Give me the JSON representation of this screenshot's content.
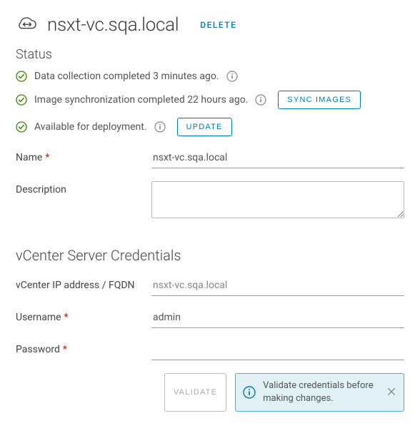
{
  "header": {
    "title": "nsxt-vc.sqa.local",
    "delete_label": "DELETE"
  },
  "status": {
    "section_label": "Status",
    "items": [
      {
        "text": "Data collection completed 3 minutes ago."
      },
      {
        "text": "Image synchronization completed 22 hours ago.",
        "action_label": "SYNC IMAGES"
      },
      {
        "text": "Available for deployment.",
        "action_label": "UPDATE"
      }
    ]
  },
  "form": {
    "name_label": "Name",
    "name_value": "nsxt-vc.sqa.local",
    "description_label": "Description",
    "description_value": ""
  },
  "credentials": {
    "section_label": "vCenter Server Credentials",
    "ip_label": "vCenter IP address / FQDN",
    "ip_value": "nsxt-vc.sqa.local",
    "username_label": "Username",
    "username_value": "admin",
    "password_label": "Password",
    "password_value": "",
    "validate_label": "VALIDATE",
    "alert_text": "Validate credentials before making changes."
  },
  "colors": {
    "primary": "#0079b8",
    "success": "#3c8500",
    "danger": "#c92100",
    "info_bg": "#e1f1f6",
    "info_border": "#49afd9"
  }
}
